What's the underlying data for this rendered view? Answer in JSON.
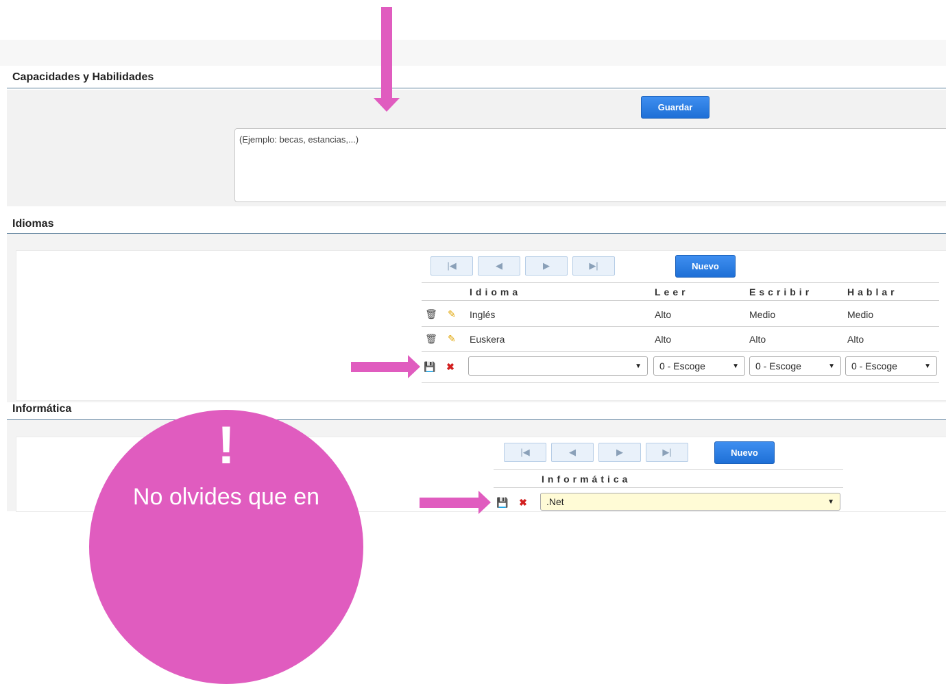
{
  "sections": {
    "capacidades": "Capacidades y Habilidades",
    "idiomas": "Idiomas",
    "informatica": "Informática"
  },
  "capacidades": {
    "save_label": "Guardar",
    "textarea_value": "(Ejemplo: becas, estancias,...)"
  },
  "idiomas_grid": {
    "new_label": "Nuevo",
    "headers": {
      "idioma": "Idioma",
      "leer": "Leer",
      "escribir": "Escribir",
      "hablar": "Hablar"
    },
    "rows": [
      {
        "idioma": "Inglés",
        "leer": "Alto",
        "escribir": "Medio",
        "hablar": "Medio"
      },
      {
        "idioma": "Euskera",
        "leer": "Alto",
        "escribir": "Alto",
        "hablar": "Alto"
      }
    ],
    "new_row": {
      "idioma": "",
      "leer": "0 - Escoge",
      "escribir": "0 - Escoge",
      "hablar": "0 - Escoge"
    }
  },
  "informatica_grid": {
    "new_label": "Nuevo",
    "header": "Informática",
    "new_row_value": ".Net"
  },
  "callout": {
    "mark": "!",
    "text": "No olvides que en"
  },
  "colors": {
    "accent": "#e05cbf",
    "button": "#1e6fd6",
    "rule": "#5a7d9a",
    "highlight_select": "#fffbd6"
  },
  "icons": {
    "first": "first-page-icon",
    "prev": "prev-page-icon",
    "next": "next-page-icon",
    "last": "last-page-icon",
    "delete": "trash-icon",
    "edit": "pencil-icon",
    "save_row": "save-row-icon",
    "cancel_row": "cancel-row-icon",
    "annotation": "arrow-annotation"
  }
}
